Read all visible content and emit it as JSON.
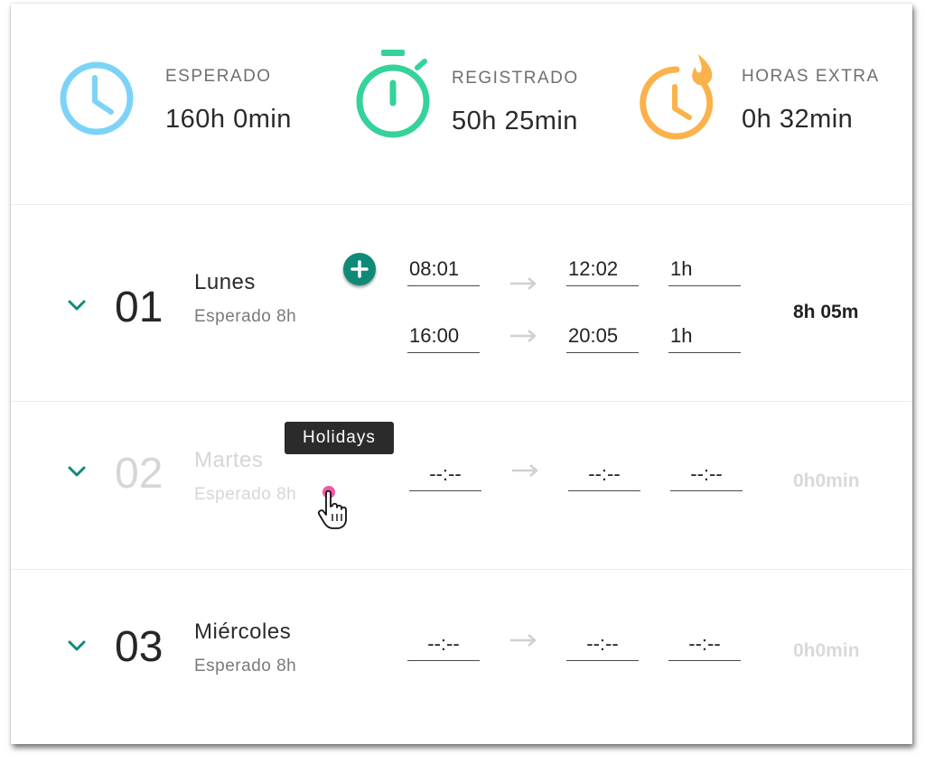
{
  "stats": [
    {
      "label": "ESPERADO",
      "value": "160h 0min",
      "icon": "clock-icon",
      "color": "#7dd3f7"
    },
    {
      "label": "REGISTRADO",
      "value": "50h 25min",
      "icon": "stopwatch-icon",
      "color": "#34d399"
    },
    {
      "label": "HORAS EXTRA",
      "value": "0h 32min",
      "icon": "clock-fire-icon",
      "color": "#fbb24b"
    }
  ],
  "days": [
    {
      "num": "01",
      "name": "Lunes",
      "expected": "Esperado 8h",
      "entries": [
        {
          "start": "08:01",
          "end": "12:02",
          "break": "1h"
        },
        {
          "start": "16:00",
          "end": "20:05",
          "break": "1h"
        }
      ],
      "total": "8h 05m"
    },
    {
      "num": "02",
      "name": "Martes",
      "expected": "Esperado 8h",
      "entries": [
        {
          "start": "--:--",
          "end": "--:--",
          "break": "--:--"
        }
      ],
      "total": "0h0min"
    },
    {
      "num": "03",
      "name": "Miércoles",
      "expected": "Esperado 8h",
      "entries": [
        {
          "start": "--:--",
          "end": "--:--",
          "break": "--:--"
        }
      ],
      "total": "0h0min"
    }
  ],
  "tooltip": {
    "text": "Holidays"
  },
  "colors": {
    "accent": "#0f8a78",
    "holiday": "#ec5aa6"
  }
}
